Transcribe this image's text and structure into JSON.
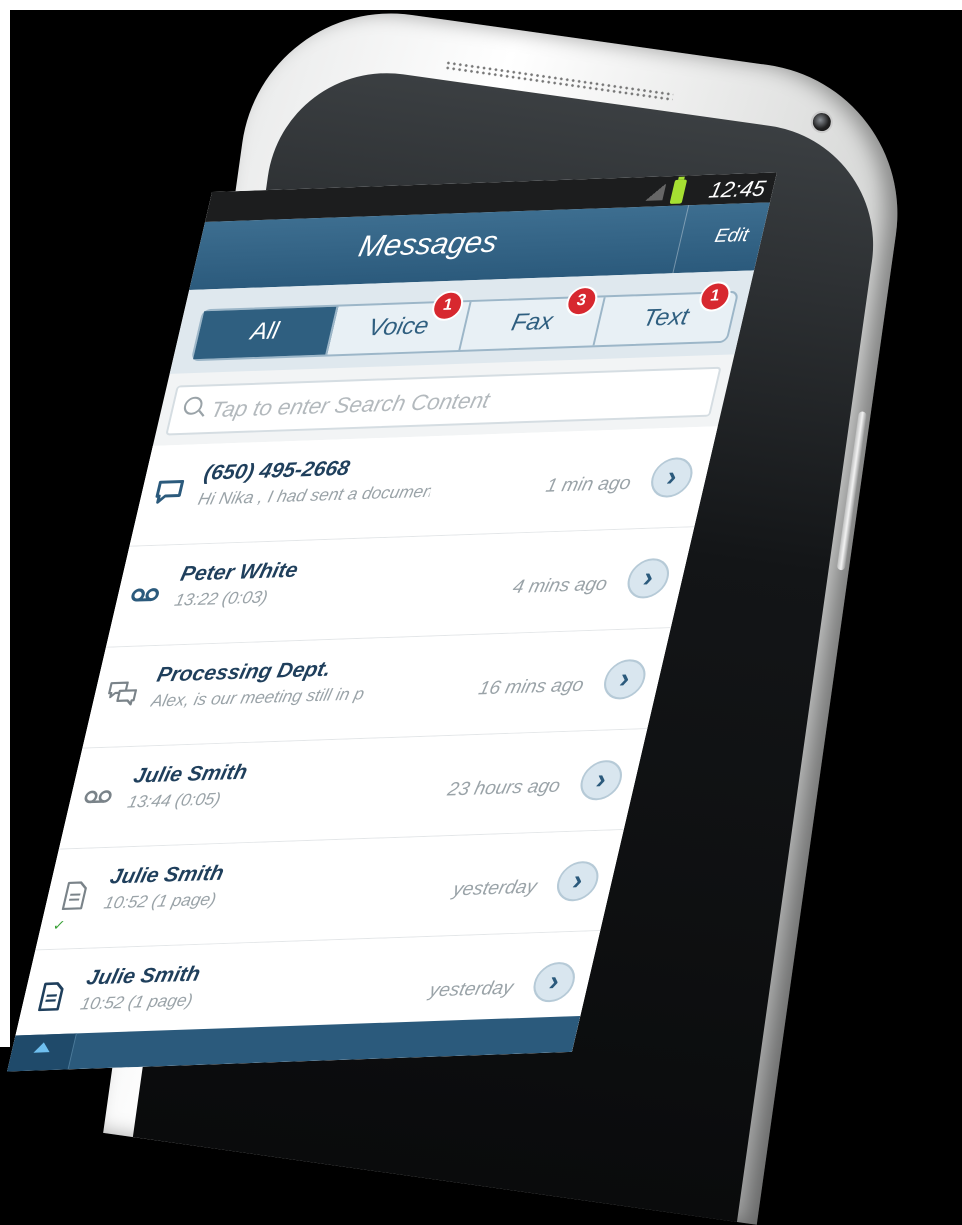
{
  "status_bar": {
    "time": "12:45"
  },
  "nav": {
    "title": "Messages",
    "edit_label": "Edit"
  },
  "tabs": [
    {
      "label": "All",
      "badge": ""
    },
    {
      "label": "Voice",
      "badge": "1"
    },
    {
      "label": "Fax",
      "badge": "3"
    },
    {
      "label": "Text",
      "badge": "1"
    }
  ],
  "search": {
    "placeholder": "Tap to enter Search Content"
  },
  "messages": [
    {
      "icon": "chat-bubble-icon",
      "name": "(650) 495-2668",
      "sub": "Hi Nika , I had sent a documen",
      "time": "1 min ago"
    },
    {
      "icon": "voicemail-icon",
      "name": "Peter White",
      "sub": "13:22 (0:03)",
      "time": "4 mins ago"
    },
    {
      "icon": "group-chat-icon",
      "name": "Processing Dept.",
      "sub": "Alex, is our meeting still in p",
      "time": "16 mins ago"
    },
    {
      "icon": "voicemail-icon",
      "name": "Julie Smith",
      "sub": "13:44 (0:05)",
      "time": "23 hours ago"
    },
    {
      "icon": "fax-document-icon",
      "name": "Julie Smith",
      "sub": "10:52 (1 page)",
      "time": "yesterday"
    },
    {
      "icon": "fax-document-icon",
      "name": "Julie Smith",
      "sub": "10:52 (1 page)",
      "time": "yesterday"
    }
  ],
  "colors": {
    "nav_blue": "#2b5a7c",
    "badge_red": "#d7282f",
    "battery_green": "#a6e032"
  }
}
